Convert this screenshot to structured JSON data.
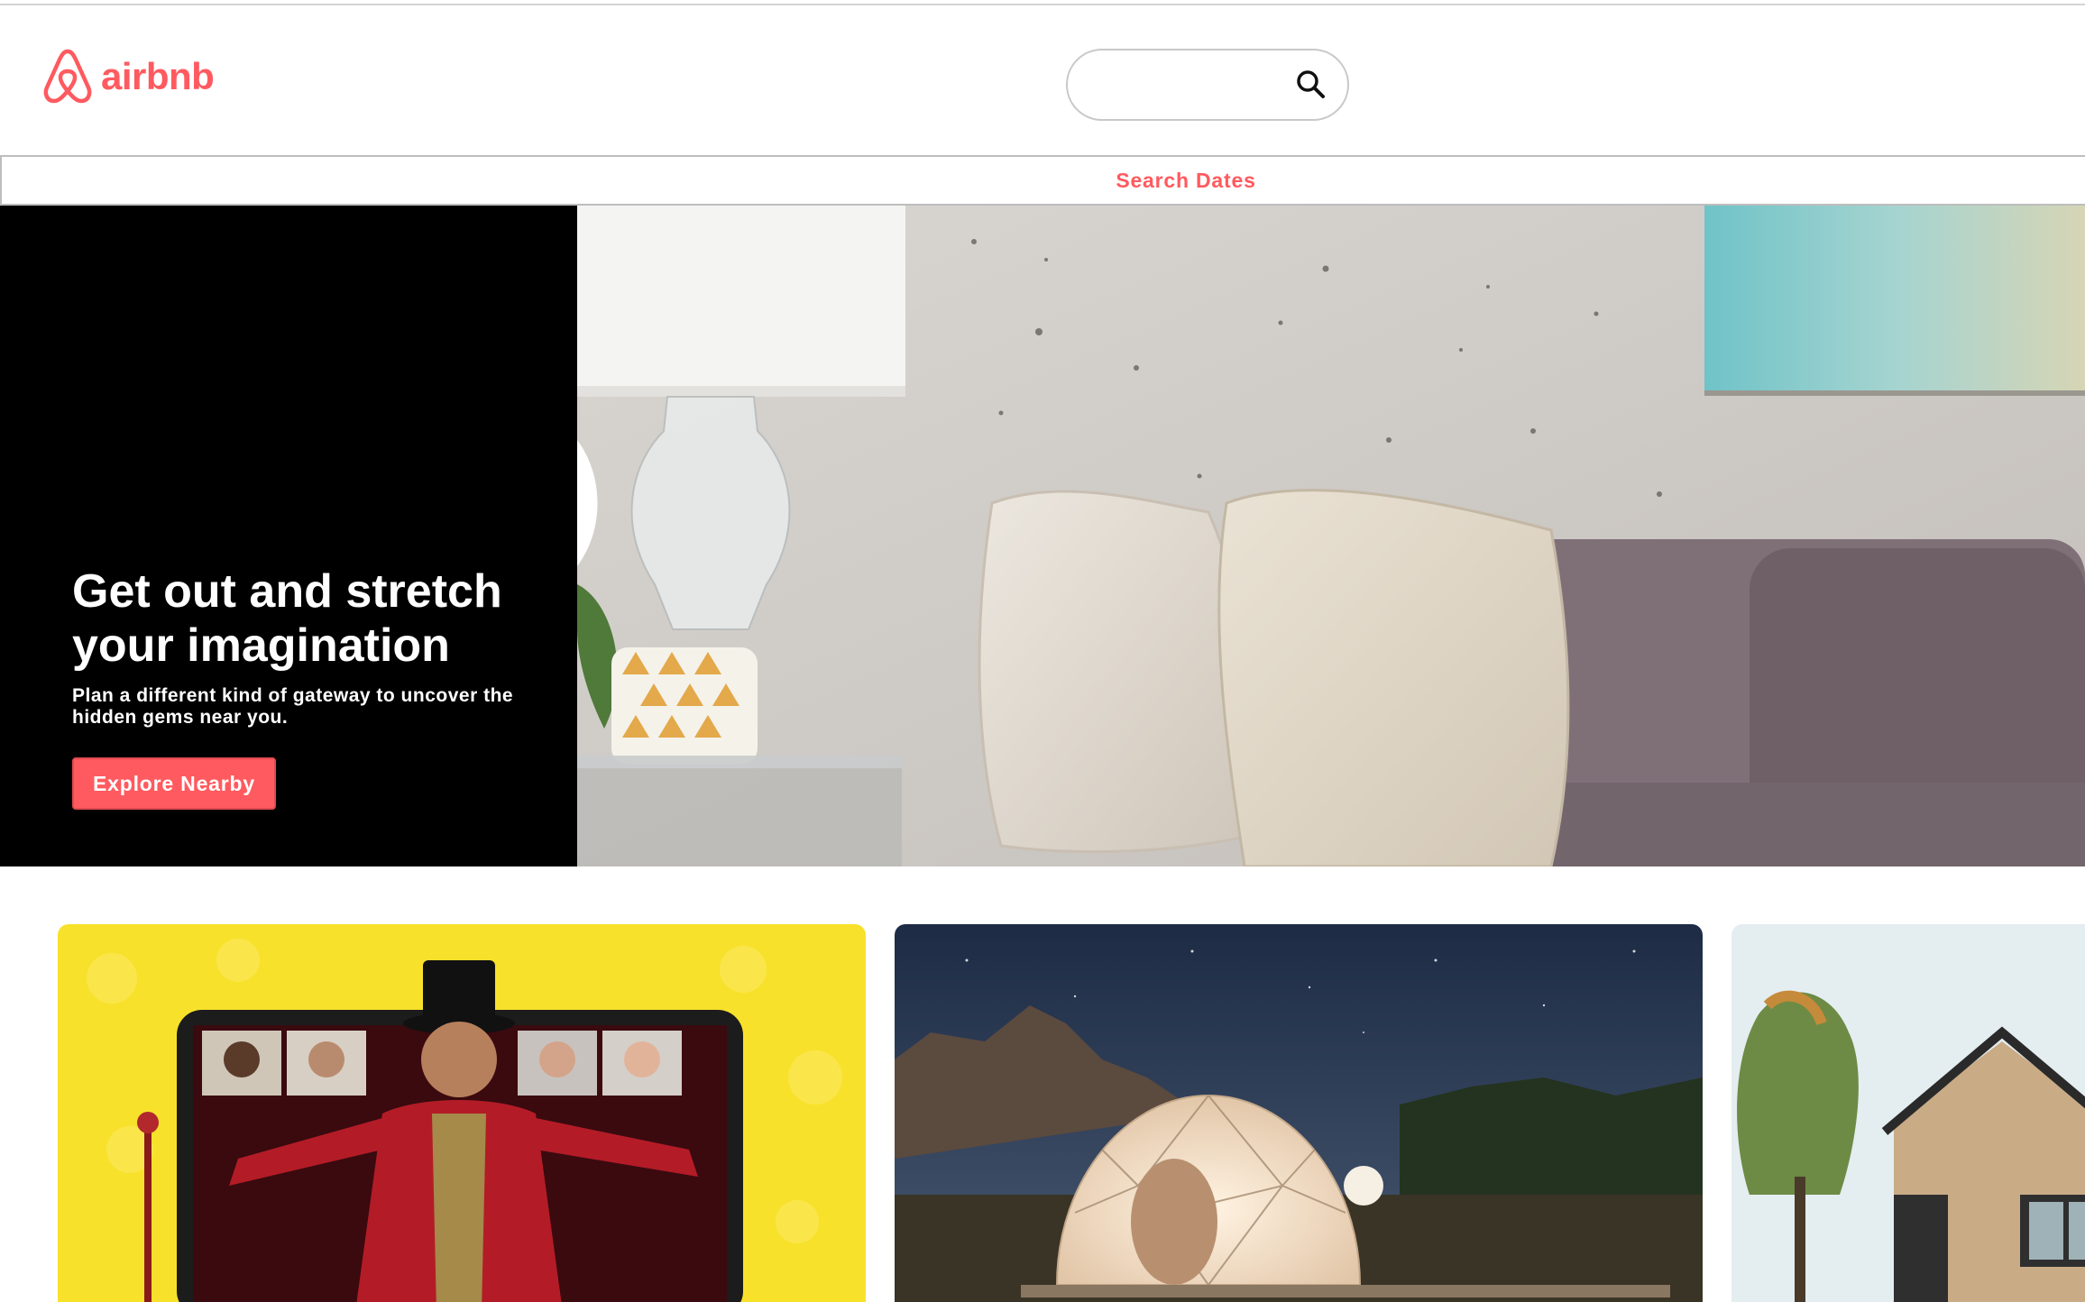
{
  "header": {
    "logo_text": "airbnb",
    "search": {
      "value": "",
      "placeholder": ""
    }
  },
  "search_dates": {
    "label": "Search Dates"
  },
  "hero": {
    "title": "Get out and stretch your imagination",
    "subtitle": "Plan a different kind of gateway to uncover the hidden gems near you.",
    "button_label": "Explore Nearby",
    "image": "living-room-pillows-lamp"
  },
  "cards": [
    {
      "image": "online-experience-ringmaster"
    },
    {
      "image": "glamping-dome-night"
    },
    {
      "image": "modern-house-trees"
    }
  ],
  "colors": {
    "brand": "#ff5a5f",
    "hero_panel": "#000000",
    "border": "#bdbdbd"
  }
}
